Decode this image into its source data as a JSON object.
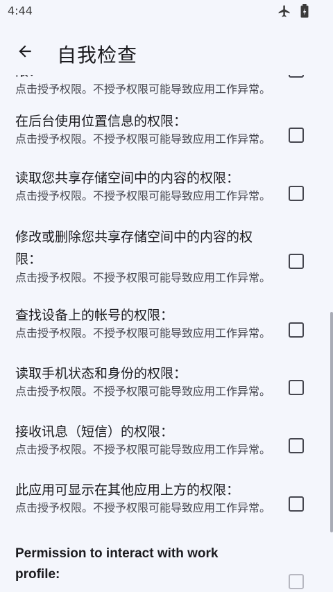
{
  "status_bar": {
    "time": "4:44",
    "icons": [
      "airplane-icon",
      "battery-icon"
    ]
  },
  "app_bar": {
    "back_icon": "arrow-left-icon",
    "title": "自我检查"
  },
  "permissions": [
    {
      "title": "限：",
      "summary": "点击授予权限。不授予权限可能导致应用工作异常。",
      "checked": false
    },
    {
      "title": "在后台使用位置信息的权限：",
      "summary": "点击授予权限。不授予权限可能导致应用工作异常。",
      "checked": false
    },
    {
      "title": "读取您共享存储空间中的内容的权限：",
      "summary": "点击授予权限。不授予权限可能导致应用工作异常。",
      "checked": false
    },
    {
      "title": "修改或删除您共享存储空间中的内容的权限：",
      "summary": "点击授予权限。不授予权限可能导致应用工作异常。",
      "checked": false
    },
    {
      "title": "查找设备上的帐号的权限：",
      "summary": "点击授予权限。不授予权限可能导致应用工作异常。",
      "checked": false
    },
    {
      "title": "读取手机状态和身份的权限：",
      "summary": "点击授予权限。不授予权限可能导致应用工作异常。",
      "checked": false
    },
    {
      "title": "接收讯息（短信）的权限：",
      "summary": "点击授予权限。不授予权限可能导致应用工作异常。",
      "checked": false
    },
    {
      "title": "此应用可显示在其他应用上方的权限：",
      "summary": "点击授予权限。不授予权限可能导致应用工作异常。",
      "checked": false
    },
    {
      "title": "Permission to interact with work profile:",
      "summary": "",
      "checked": false
    }
  ]
}
